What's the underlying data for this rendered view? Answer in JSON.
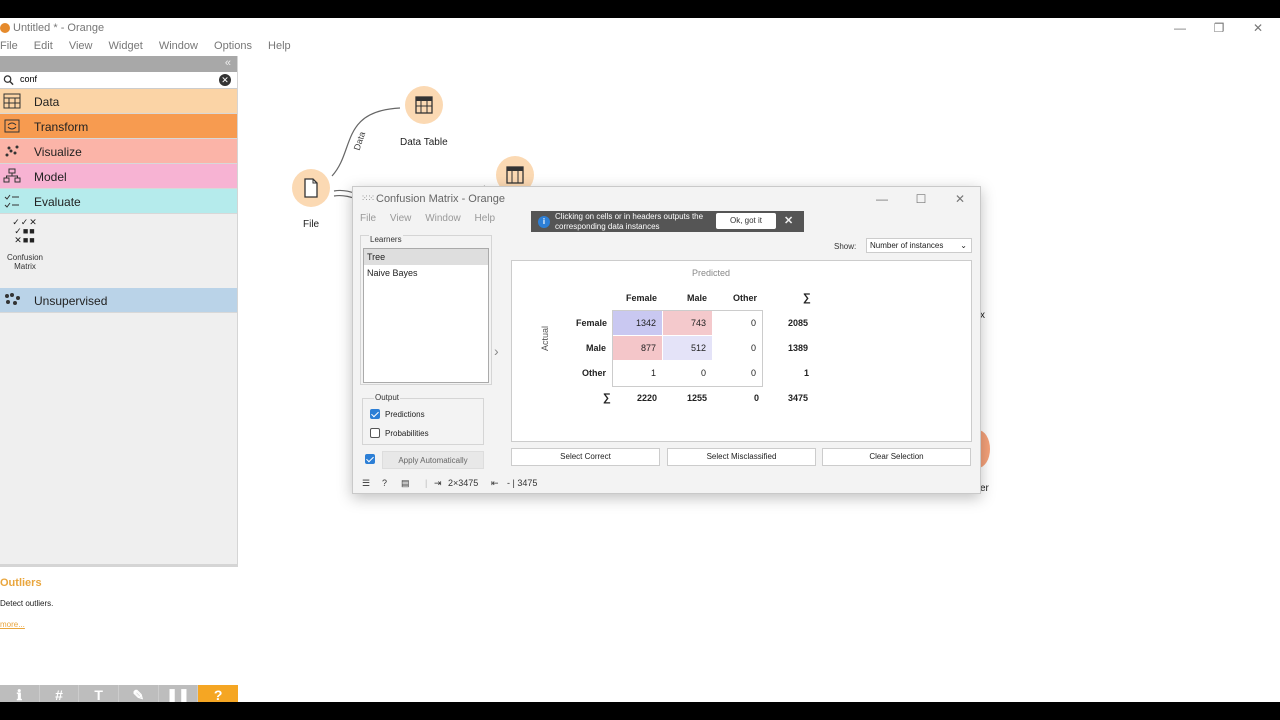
{
  "window": {
    "title": "Untitled * - Orange",
    "minimize": "—",
    "maximize": "❐",
    "close": "✕"
  },
  "menu": [
    "File",
    "Edit",
    "View",
    "Widget",
    "Window",
    "Options",
    "Help"
  ],
  "left_panel": {
    "collapse_label": "«",
    "search": {
      "value": "conf",
      "clear": "✕"
    },
    "categories": [
      {
        "label": "Data",
        "color": "#fbd4a6"
      },
      {
        "label": "Transform",
        "color": "#f79b50"
      },
      {
        "label": "Visualize",
        "color": "#fbb4a8"
      },
      {
        "label": "Model",
        "color": "#f7b3d3"
      },
      {
        "label": "Evaluate",
        "color": "#b5ebec"
      }
    ],
    "widget": {
      "label": "Confusion Matrix"
    },
    "unsupervised": {
      "label": "Unsupervised",
      "color": "#bad3e8"
    },
    "description": {
      "title": "Outliers",
      "text": "Detect outliers.",
      "more": "more..."
    },
    "toolbar": [
      "ℹ",
      "#",
      "T",
      "✎",
      "❚❚",
      "?"
    ]
  },
  "canvas": {
    "nodes": [
      {
        "label": "Data Table"
      },
      {
        "label": "File"
      }
    ],
    "link_label": "Data",
    "peek_x": "x",
    "peek_er": "er"
  },
  "dialog": {
    "title": "Confusion Matrix - Orange",
    "menu": [
      "File",
      "View",
      "Window",
      "Help"
    ],
    "tooltip": {
      "message_line1": "Clicking on cells or in headers outputs the",
      "message_line2": "corresponding data instances",
      "ok": "Ok, got it",
      "close": "✕",
      "info": "i"
    },
    "learners": {
      "label": "Learners",
      "items": [
        "Tree",
        "Naive Bayes"
      ],
      "selected": "Tree"
    },
    "output": {
      "label": "Output",
      "predictions": {
        "label": "Predictions",
        "checked": true
      },
      "probabilities": {
        "label": "Probabilities",
        "checked": false
      }
    },
    "apply": {
      "label": "Apply Automatically",
      "checked": true
    },
    "arrow": "›",
    "show": {
      "label": "Show:",
      "value": "Number of instances"
    },
    "matrix": {
      "predicted_label": "Predicted",
      "actual_label": "Actual",
      "columns": [
        "Female",
        "Male",
        "Other"
      ],
      "sum_symbol": "∑",
      "rows": [
        {
          "label": "Female",
          "cells": [
            "1342",
            "743",
            "0"
          ],
          "sum": "2085"
        },
        {
          "label": "Male",
          "cells": [
            "877",
            "512",
            "0"
          ],
          "sum": "1389"
        },
        {
          "label": "Other",
          "cells": [
            "1",
            "0",
            "0"
          ],
          "sum": "1"
        }
      ],
      "col_sums": [
        "2220",
        "1255",
        "0"
      ],
      "total": "3475",
      "cell_colors": [
        [
          "#c9c8f1",
          "#f4c9cc",
          "#ffffff"
        ],
        [
          "#f4c6c9",
          "#e4e3f8",
          "#ffffff"
        ],
        [
          "#ffffff",
          "#ffffff",
          "#ffffff"
        ]
      ]
    },
    "buttons": {
      "select_correct": "Select Correct",
      "select_misclassified": "Select Misclassified",
      "clear_selection": "Clear Selection"
    },
    "status": {
      "input": "2×3475",
      "output": "- | 3475"
    }
  }
}
